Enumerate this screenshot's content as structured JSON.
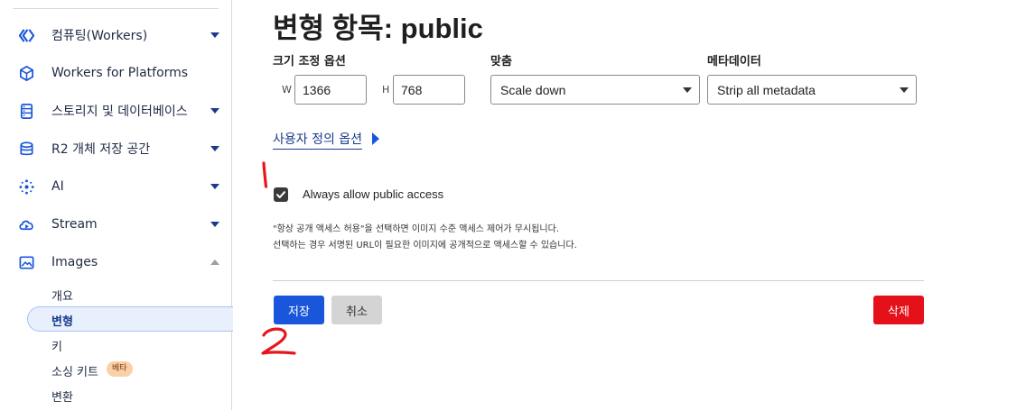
{
  "sidebar": {
    "items": [
      {
        "label": "컴퓨팅(Workers)",
        "icon": "workers-icon",
        "caret": "down"
      },
      {
        "label": "Workers for Platforms",
        "icon": "cube-icon"
      },
      {
        "label": "스토리지 및 데이터베이스",
        "icon": "database-icon",
        "caret": "down"
      },
      {
        "label": "R2 개체 저장 공간",
        "icon": "bucket-icon",
        "caret": "down"
      },
      {
        "label": "AI",
        "icon": "sparkle-icon",
        "caret": "down"
      },
      {
        "label": "Stream",
        "icon": "cloud-play-icon",
        "caret": "down"
      },
      {
        "label": "Images",
        "icon": "image-icon",
        "caret": "up"
      }
    ],
    "sub_items": [
      {
        "label": "개요"
      },
      {
        "label": "변형",
        "active": true
      },
      {
        "label": "키"
      },
      {
        "label": "소싱 키트",
        "badge": "베타"
      },
      {
        "label": "변환"
      }
    ]
  },
  "main": {
    "title": "변형 항목: public",
    "resize": {
      "label": "크기 조정 옵션",
      "width_prefix": "W",
      "width_value": "1366",
      "height_prefix": "H",
      "height_value": "768"
    },
    "fit": {
      "label": "맞춤",
      "value": "Scale down"
    },
    "metadata": {
      "label": "메타데이터",
      "value": "Strip all metadata"
    },
    "custom_options_link": "사용자 정의 옵션",
    "public_access": {
      "checked": true,
      "label": "Always allow public access",
      "help_line1": "\"항상 공개 액세스 허용\"을 선택하면 이미지 수준 액세스 제어가 무시됩니다.",
      "help_line2": "선택하는 경우 서명된 URL이 필요한 이미지에 공개적으로 액세스할 수 있습니다."
    },
    "buttons": {
      "save": "저장",
      "cancel": "취소",
      "delete": "삭제"
    }
  },
  "annotations": {
    "mark1": "1",
    "mark2": "2",
    "color": "#e8161c"
  },
  "colors": {
    "primary": "#1a56db",
    "danger": "#e4111b",
    "link": "#1a3a8a",
    "active_bg": "#e8f0fe"
  }
}
